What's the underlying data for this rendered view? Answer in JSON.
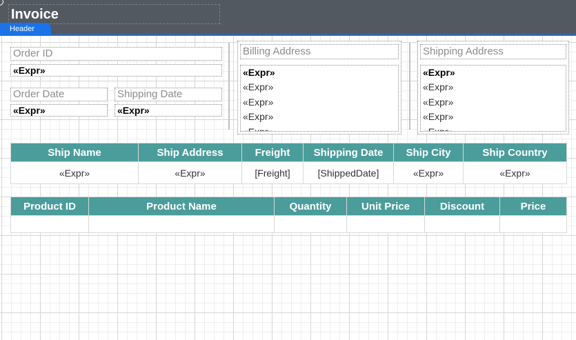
{
  "report": {
    "title": "Invoice",
    "band_label": "Header"
  },
  "order": {
    "order_id_label": "Order ID",
    "order_id_value": "«Expr»",
    "order_date_label": "Order Date",
    "order_date_value": "«Expr»",
    "shipping_date_label": "Shipping Date",
    "shipping_date_value": "«Expr»"
  },
  "billing": {
    "label": "Billing Address",
    "lines": [
      "«Expr»",
      "«Expr»",
      "«Expr»",
      "«Expr»",
      "«Expr»"
    ]
  },
  "shipping": {
    "label": "Shipping Address",
    "lines": [
      "«Expr»",
      "«Expr»",
      "«Expr»",
      "«Expr»",
      "«Expr»"
    ]
  },
  "ship_table": {
    "headers": [
      "Ship Name",
      "Ship Address",
      "Freight",
      "Shipping Date",
      "Ship City",
      "Ship Country"
    ],
    "row": [
      "«Expr»",
      "«Expr»",
      "[Freight]",
      "[ShippedDate]",
      "«Expr»",
      "«Expr»"
    ]
  },
  "product_table": {
    "headers": [
      "Product ID",
      "Product Name",
      "Quantity",
      "Unit Price",
      "Discount",
      "Price"
    ],
    "row": [
      "",
      "",
      "",
      "",
      "",
      ""
    ]
  },
  "colors": {
    "header_band": "#535961",
    "band_tab": "#1a73e8",
    "table_header": "#4a9d9b"
  }
}
